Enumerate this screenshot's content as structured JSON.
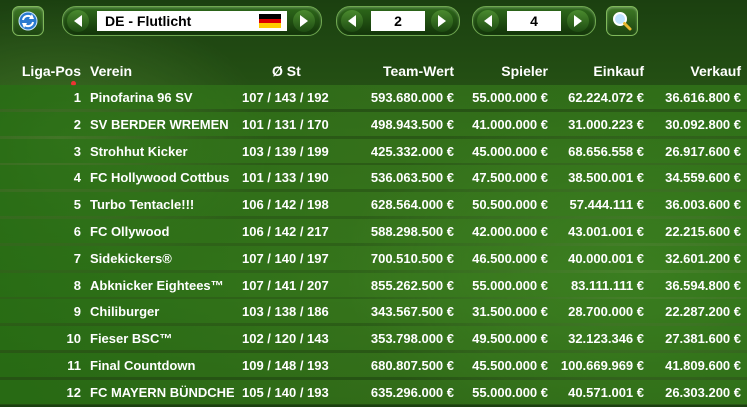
{
  "toolbar": {
    "league_name": "DE - Flutlicht",
    "season_value": "2",
    "matchday_value": "4"
  },
  "table": {
    "columns": [
      "Liga-Pos",
      "Verein",
      "Ø St",
      "Team-Wert",
      "Spieler",
      "Einkauf",
      "Verkauf"
    ],
    "rows": [
      [
        "1",
        "Pinofarina 96 SV",
        "107 / 143 / 192",
        "593.680.000 €",
        "55.000.000 €",
        "62.224.072 €",
        "36.616.800 €"
      ],
      [
        "2",
        "SV BERDER WREMEN",
        "101 / 131 / 170",
        "498.943.500 €",
        "41.000.000 €",
        "31.000.223 €",
        "30.092.800 €"
      ],
      [
        "3",
        "Strohhut Kicker",
        "103 / 139 / 199",
        "425.332.000 €",
        "45.000.000 €",
        "68.656.558 €",
        "26.917.600 €"
      ],
      [
        "4",
        "FC Hollywood Cottbus",
        "101 / 133 / 190",
        "536.063.500 €",
        "47.500.000 €",
        "38.500.001 €",
        "34.559.600 €"
      ],
      [
        "5",
        "Turbo Tentacle!!!",
        "106 / 142 / 198",
        "628.564.000 €",
        "50.500.000 €",
        "57.444.111 €",
        "36.003.600 €"
      ],
      [
        "6",
        "FC Ollywood",
        "106 / 142 / 217",
        "588.298.500 €",
        "42.000.000 €",
        "43.001.001 €",
        "22.215.600 €"
      ],
      [
        "7",
        "Sidekickers®",
        "107 / 140 / 197",
        "700.510.500 €",
        "46.500.000 €",
        "40.000.001 €",
        "32.601.200 €"
      ],
      [
        "8",
        "Abknicker Eightees™",
        "107 / 141 / 207",
        "855.262.500 €",
        "55.000.000 €",
        "83.111.111 €",
        "36.594.800 €"
      ],
      [
        "9",
        "Chiliburger",
        "103 / 138 / 186",
        "343.567.500 €",
        "31.500.000 €",
        "28.700.000 €",
        "22.287.200 €"
      ],
      [
        "10",
        "Fieser BSC™",
        "102 / 120 / 143",
        "353.798.000 €",
        "49.500.000 €",
        "32.123.346 €",
        "27.381.600 €"
      ],
      [
        "11",
        "Final Countdown",
        "109 / 148 / 193",
        "680.807.500 €",
        "45.500.000 €",
        "100.669.969 €",
        "41.809.600 €"
      ],
      [
        "12",
        "FC MAYERN BÜNDCHEN",
        "105 / 140 / 193",
        "635.296.000 €",
        "55.000.000 €",
        "40.571.001 €",
        "26.303.200 €"
      ]
    ]
  },
  "icons": {
    "refresh": "refresh-icon",
    "search": "search-icon",
    "flag": "germany-flag-icon"
  },
  "colors": {
    "accent": "#2f6519",
    "flag": [
      "#000000",
      "#dd0000",
      "#ffce00"
    ]
  }
}
